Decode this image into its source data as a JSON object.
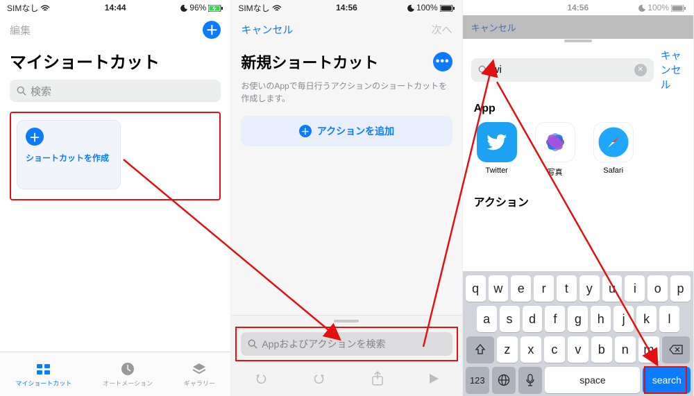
{
  "panel1": {
    "status": {
      "carrier": "SIMなし",
      "time": "14:44",
      "battery": "96%"
    },
    "edit": "編集",
    "title": "マイショートカット",
    "searchPlaceholder": "検索",
    "createCardLabel": "ショートカットを作成",
    "tabs": [
      {
        "label": "マイショートカット",
        "active": true
      },
      {
        "label": "オートメーション",
        "active": false
      },
      {
        "label": "ギャラリー",
        "active": false
      }
    ]
  },
  "panel2": {
    "status": {
      "carrier": "SIMなし",
      "time": "14:56",
      "battery": "100%"
    },
    "cancel": "キャンセル",
    "next": "次へ",
    "title": "新規ショートカット",
    "desc": "お使いのAppで毎日行うアクションのショートカットを作成します。",
    "addAction": "アクションを追加",
    "drawerPlaceholder": "Appおよびアクションを検索"
  },
  "panel3": {
    "status": {
      "carrier": "",
      "time": "14:56",
      "battery": "100%"
    },
    "dimCancel": "キャンセル",
    "searchValue": "wi",
    "cancel": "キャンセル",
    "appHeader": "App",
    "apps": [
      {
        "name": "Twitter"
      },
      {
        "name": "写真"
      },
      {
        "name": "Safari"
      }
    ],
    "actionHeader": "アクション",
    "keyboard": {
      "row1": [
        "q",
        "w",
        "e",
        "r",
        "t",
        "y",
        "u",
        "i",
        "o",
        "p"
      ],
      "row2": [
        "a",
        "s",
        "d",
        "f",
        "g",
        "h",
        "j",
        "k",
        "l"
      ],
      "row3": [
        "z",
        "x",
        "c",
        "v",
        "b",
        "n",
        "m"
      ],
      "numKey": "123",
      "space": "space",
      "search": "search"
    }
  }
}
